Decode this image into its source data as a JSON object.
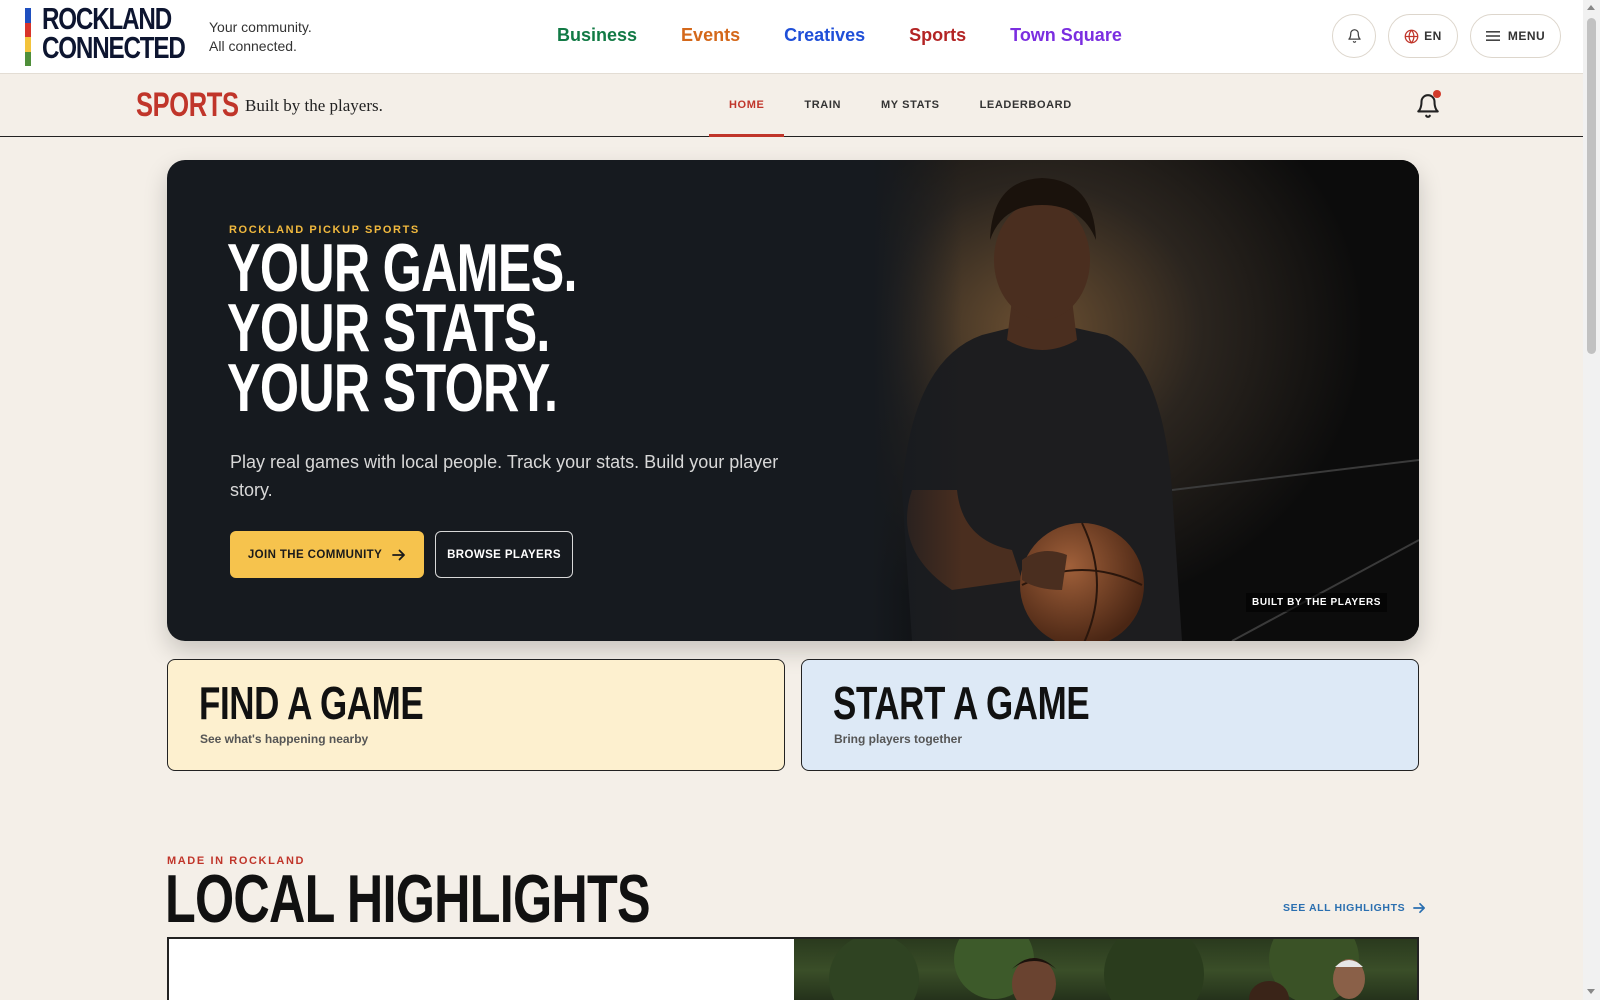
{
  "brand": {
    "logo_line1": "ROCKLAND",
    "logo_line2": "CONNECTED",
    "tagline_line1": "Your community.",
    "tagline_line2": "All connected.",
    "stripe_colors": [
      "#1f4fbf",
      "#d8342a",
      "#f3c33b",
      "#4f8f3a"
    ]
  },
  "main_nav": [
    {
      "label": "Business",
      "color": "#127a45"
    },
    {
      "label": "Events",
      "color": "#d4681a"
    },
    {
      "label": "Creatives",
      "color": "#1f4fd8"
    },
    {
      "label": "Sports",
      "color": "#b32424"
    },
    {
      "label": "Town Square",
      "color": "#7b2ee0"
    }
  ],
  "header_actions": {
    "language": "EN",
    "menu_label": "MENU"
  },
  "sports_nav": {
    "title": "SPORTS",
    "tagline": "Built by the players.",
    "tabs": [
      {
        "label": "HOME",
        "active": true
      },
      {
        "label": "TRAIN",
        "active": false
      },
      {
        "label": "MY STATS",
        "active": false
      },
      {
        "label": "LEADERBOARD",
        "active": false
      }
    ],
    "has_unread_notification": true
  },
  "hero": {
    "eyebrow": "ROCKLAND PICKUP SPORTS",
    "headline": [
      "YOUR GAMES.",
      "YOUR STATS.",
      "YOUR STORY."
    ],
    "subtitle": "Play real games with local people. Track your stats. Build your player story.",
    "primary_button": "JOIN THE COMMUNITY",
    "secondary_button": "BROWSE PLAYERS",
    "photo_badge": "BUILT BY THE PLAYERS"
  },
  "cards": [
    {
      "title": "FIND A GAME",
      "subtitle": "See what's happening nearby",
      "bg": "#fdf0cf"
    },
    {
      "title": "START A GAME",
      "subtitle": "Bring players together",
      "bg": "#dde9f6"
    }
  ],
  "highlights": {
    "eyebrow": "MADE IN ROCKLAND",
    "title": "LOCAL HIGHLIGHTS",
    "see_all": "SEE ALL HIGHLIGHTS"
  }
}
